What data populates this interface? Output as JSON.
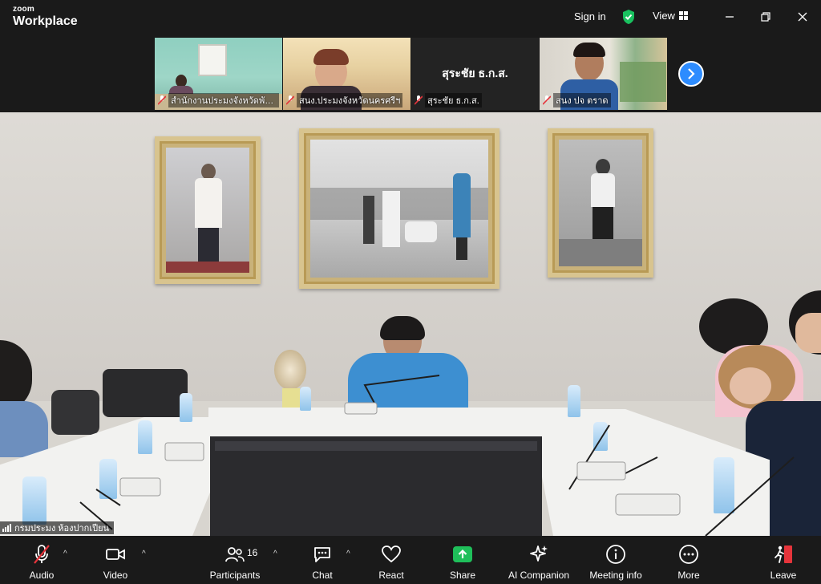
{
  "app": {
    "brand_top": "zoom",
    "brand_bottom": "Workplace",
    "sign_in": "Sign in",
    "view": "View"
  },
  "thumbnails": [
    {
      "name": "สำนักงานประมงจังหวัดพัท...",
      "muted": true
    },
    {
      "name": "สนง.ประมงจังหวัดนครศรีฯ",
      "muted": true
    },
    {
      "name": "สุระชัย ธ.ก.ส.",
      "display_name": "สุระชัย ธ.ก.ส.",
      "muted": true
    },
    {
      "name": "สนง ปจ ตราด",
      "muted": true
    }
  ],
  "main_video": {
    "label": "กรมประมง ห้องปากเปียน"
  },
  "toolbar": {
    "audio": "Audio",
    "video": "Video",
    "participants": "Participants",
    "participants_count": "16",
    "chat": "Chat",
    "react": "React",
    "share": "Share",
    "ai_companion": "AI Companion",
    "meeting_info": "Meeting info",
    "more": "More",
    "leave": "Leave"
  },
  "colors": {
    "accent": "#2d8cff",
    "share_green": "#1fbf5a",
    "leave_red": "#e5343b",
    "shield_green": "#19c15f",
    "muted_red": "#e5343b"
  }
}
